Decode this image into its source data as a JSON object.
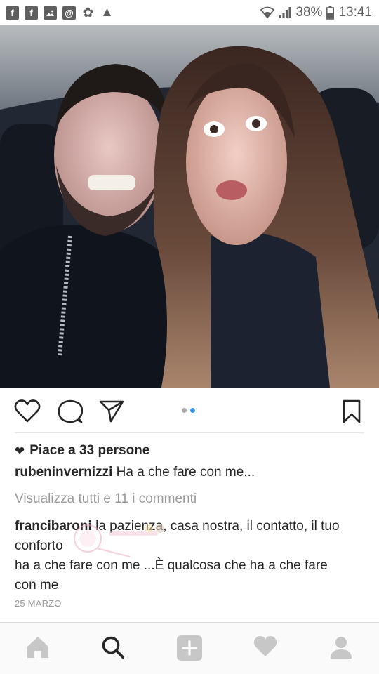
{
  "status_bar": {
    "left_icons": [
      "facebook-icon",
      "facebook-icon",
      "gallery-icon",
      "at-icon",
      "flower-icon",
      "warning-icon"
    ],
    "facebook_glyph": "f",
    "at_glyph": "@",
    "flower_glyph": "✿",
    "warning_glyph": "▲",
    "battery": "38%",
    "time": "13:41"
  },
  "post": {
    "photo_icon": "selfie-photo",
    "likes_text": "Piace a 33 persone",
    "caption": {
      "username": "rubeninvernizzi",
      "text": "Ha a che fare con me..."
    },
    "view_all_comments": "Visualizza tutti e 11 i commenti",
    "comment": {
      "username": "francibaroni",
      "line1": "la pazienza, casa nostra, il contatto, il tuo",
      "line2": "conforto",
      "line3": "ha a che fare con me ...È qualcosa che ha a che fare",
      "line4": "con me"
    },
    "date": "25 MARZO",
    "carousel": {
      "count": 2,
      "active_index": 1
    }
  },
  "actions": [
    "like-icon",
    "comment-icon",
    "share-icon",
    "bookmark-icon"
  ],
  "bottom_nav": [
    "home-icon",
    "search-icon",
    "add-icon",
    "activity-icon",
    "profile-icon"
  ],
  "colors": {
    "text": "#262626",
    "muted": "#999999",
    "carousel_active": "#3897f0",
    "carousel_inactive": "#a8a8a8",
    "nav_inactive": "#c7c7c7",
    "nav_active": "#262626"
  }
}
